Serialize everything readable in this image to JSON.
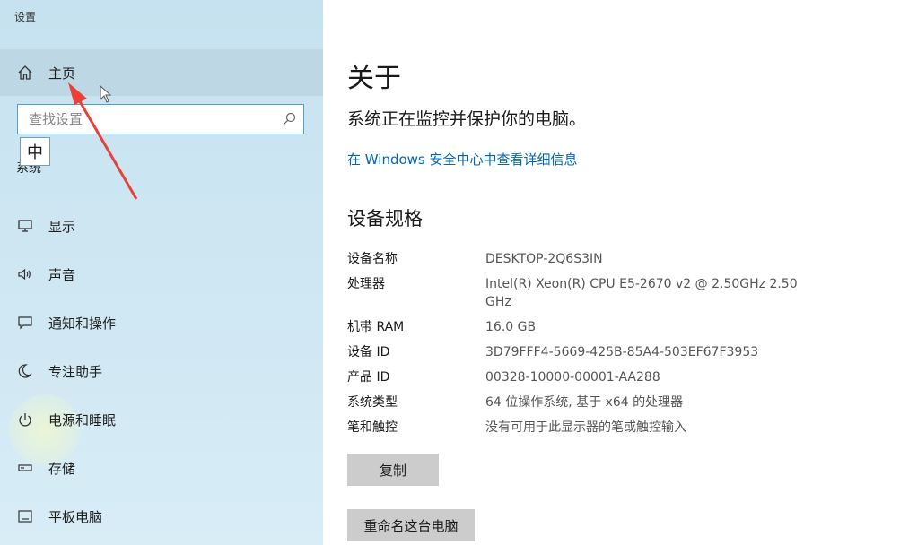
{
  "window": {
    "title": "设置"
  },
  "sidebar": {
    "home_label": "主页",
    "search_placeholder": "查找设置",
    "ime_indicator": "中",
    "section_label": "系统",
    "items": [
      {
        "label": "显示",
        "icon": "monitor-icon"
      },
      {
        "label": "声音",
        "icon": "speaker-icon"
      },
      {
        "label": "通知和操作",
        "icon": "notification-icon"
      },
      {
        "label": "专注助手",
        "icon": "moon-icon"
      },
      {
        "label": "电源和睡眠",
        "icon": "power-icon"
      },
      {
        "label": "存储",
        "icon": "storage-icon"
      },
      {
        "label": "平板电脑",
        "icon": "tablet-icon"
      }
    ]
  },
  "main": {
    "title": "关于",
    "status": "系统正在监控并保护你的电脑。",
    "security_link": "在 Windows 安全中心中查看详细信息",
    "specs_title": "设备规格",
    "specs": [
      {
        "key": "设备名称",
        "value": "DESKTOP-2Q6S3IN"
      },
      {
        "key": "处理器",
        "value": "Intel(R) Xeon(R) CPU E5-2670 v2 @ 2.50GHz   2.50 GHz"
      },
      {
        "key": "机带 RAM",
        "value": "16.0 GB"
      },
      {
        "key": "设备 ID",
        "value": "3D79FFF4-5669-425B-85A4-503EF67F3953"
      },
      {
        "key": "产品 ID",
        "value": "00328-10000-00001-AA288"
      },
      {
        "key": "系统类型",
        "value": "64 位操作系统, 基于 x64 的处理器"
      },
      {
        "key": "笔和触控",
        "value": "没有可用于此显示器的笔或触控输入"
      }
    ],
    "copy_button": "复制",
    "rename_button": "重命名这台电脑"
  },
  "colors": {
    "accent": "#0067b8",
    "annotation_arrow": "#e8413a"
  }
}
